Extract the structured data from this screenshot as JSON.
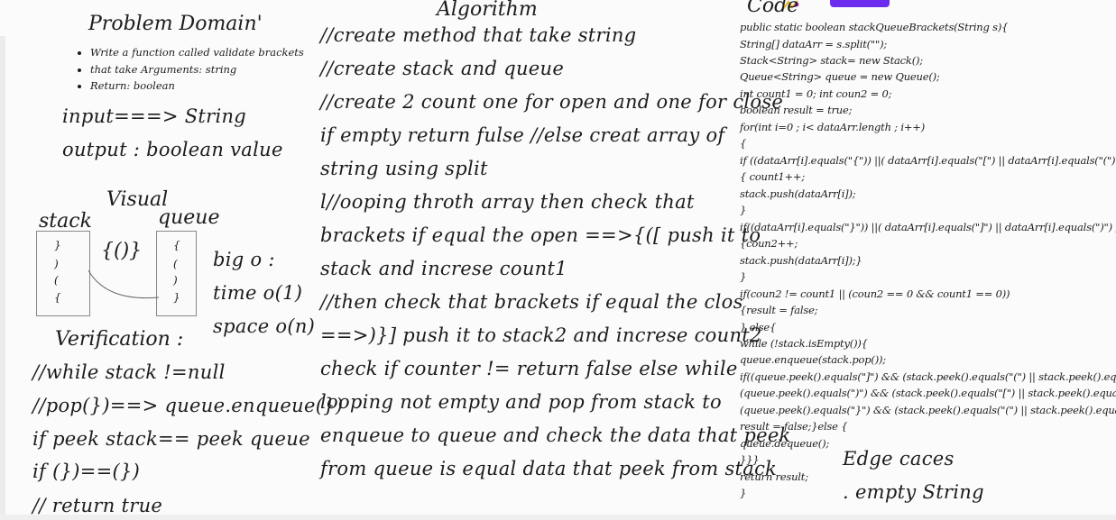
{
  "problem": {
    "title": "Problem Domain'",
    "bullets": [
      "Write a function called validate brackets",
      "that take Arguments: string",
      "Return: boolean"
    ],
    "input": "input===> String",
    "output": "output : boolean value"
  },
  "visual": {
    "title": "Visual",
    "stack_label": "stack",
    "queue_label": "queue",
    "brackets": "{()}",
    "stack_chars": [
      "}",
      ")",
      "(",
      "{"
    ],
    "queue_chars": [
      "{",
      "(",
      ")",
      "}"
    ],
    "bigo": "big o :",
    "time": "time o(1)",
    "space": "space o(n)"
  },
  "verification": {
    "title": "Verification :",
    "lines": [
      "//while stack !=null",
      "//pop(})==> queue.enqueue(})",
      "if  peek stack== peek queue",
      "if (})==(})",
      "// return true"
    ]
  },
  "algorithm": {
    "title": "Algorithm",
    "lines": [
      "//create method that take string",
      "//create stack and queue",
      "//create 2 count one for open and one for close",
      "if empty return fulse //else creat array of",
      "string using split",
      "l//ooping throth array then check that",
      "brackets if equal the open ==>{([ push it to",
      "stack and increse count1",
      "//then check that brackets if equal the clos",
      "==>)}] push it to stack2 and increse count2",
      "check if counter != return false else while",
      "looping not empty and pop from stack to",
      "enqueue to queue and check the data that peek",
      "from queue is equal data that peek from stack"
    ]
  },
  "code": {
    "title": "Code",
    "lines": [
      "public static boolean stackQueueBrackets(String s){",
      "  String[] dataArr = s.split(\"\");",
      "    Stack<String> stack= new Stack();",
      "    Queue<String> queue = new Queue();",
      "    int count1 = 0; int coun2 = 0;",
      "    boolean result = true;",
      "    for(int i=0 ; i< dataArr.length ; i++)",
      "    {",
      "      if ((dataArr[i].equals(\"{\")) ||( dataArr[i].equals(\"[\")  || dataArr[i].equals(\"(\") ))",
      "      { count1++;",
      "        stack.push(dataArr[i]);",
      "      }",
      "      if((dataArr[i].equals(\"}\")) ||( dataArr[i].equals(\"]\")  || dataArr[i].equals(\")\") ))",
      "      {coun2++;",
      "        stack.push(dataArr[i]);}",
      "    }",
      "    if(coun2 != count1 || (coun2 == 0 && count1 == 0))",
      "    {result = false;",
      "    } else{",
      "      while (!stack.isEmpty()){",
      "        queue.enqueue(stack.pop());",
      "        if((queue.peek().equals(\"]\")  && (stack.peek().equals(\"(\")  || stack.peek().equals(\"{",
      "          (queue.peek().equals(\")\")  && (stack.peek().equals(\"[\")  || stack.peek().equals(\"{",
      "          (queue.peek().equals(\"}\")  && (stack.peek().equals(\"(\")  || stack.peek().equals(\"[",
      "          result = false;}else {",
      "          queue.dequeue();",
      "        }}}",
      "    return  result;",
      "  }"
    ]
  },
  "edge": {
    "title": "Edge caces",
    "item": ". empty String"
  }
}
